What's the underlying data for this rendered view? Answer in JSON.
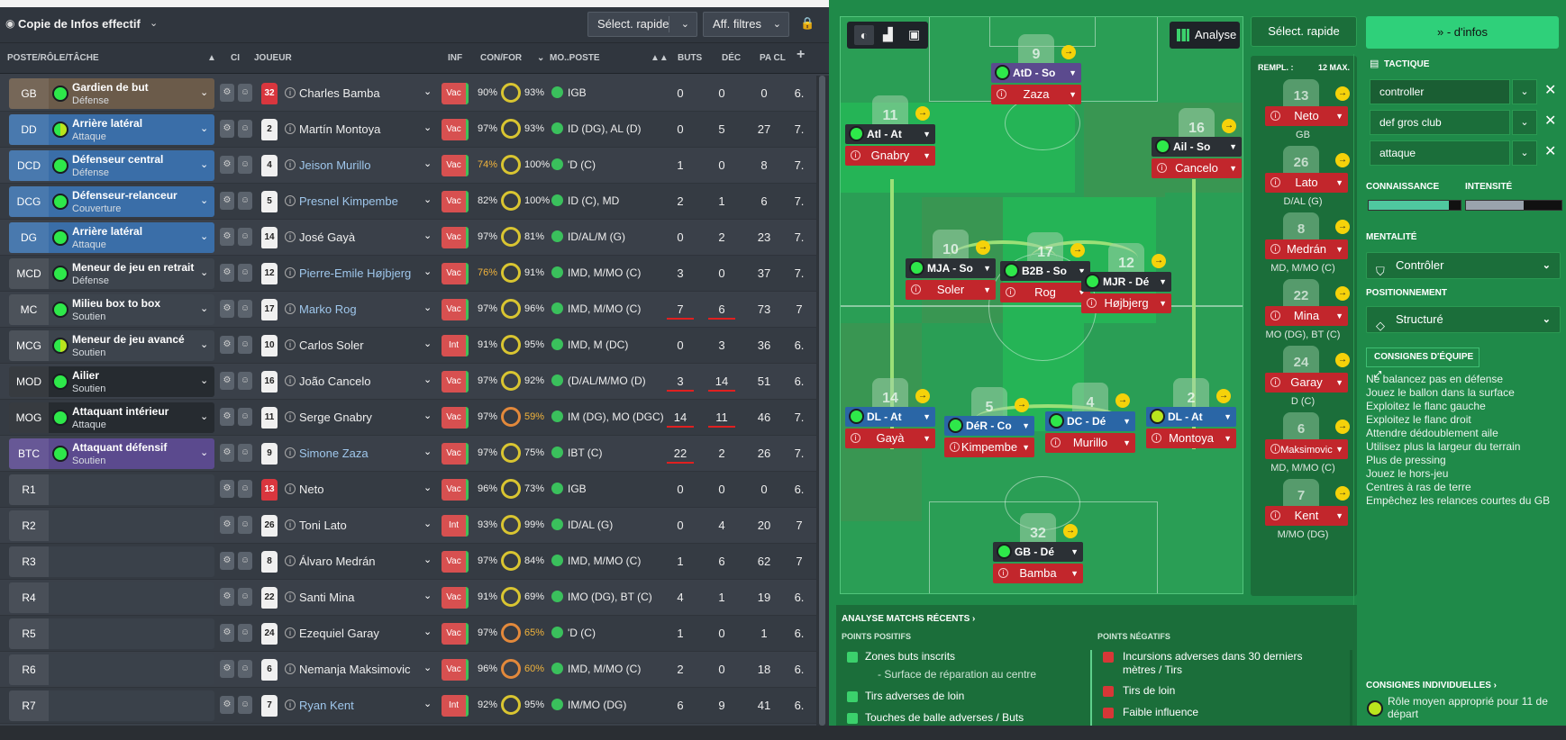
{
  "toolbar": {
    "title": "Copie de Infos effectif",
    "quick_select": "Sélect. rapide",
    "filters": "Aff. filtres"
  },
  "columns": {
    "role": "POSTE/RÔLE/TÂCHE",
    "ci": "CI",
    "player": "JOUEUR",
    "inf": "INF",
    "confor": "CON/FOR",
    "mopos": "MO..POSTE",
    "goals": "BUTS",
    "assists": "DÉC",
    "pacl": "PA CL",
    "plus": "+"
  },
  "rows": [
    {
      "pos": "GB",
      "role": "Gardien de but",
      "duty": "Défense",
      "num": "32",
      "name": "Charles Bamba",
      "inf": "Vac",
      "con": "90%",
      "for": "93%",
      "post": "IGB",
      "buts": "0",
      "dec": "0",
      "pa": "0",
      "x": "6."
    },
    {
      "pos": "DD",
      "role": "Arrière latéral",
      "duty": "Attaque",
      "num": "2",
      "name": "Martín Montoya",
      "inf": "Vac",
      "con": "97%",
      "for": "93%",
      "post": "ID (DG), AL (D)",
      "buts": "0",
      "dec": "5",
      "pa": "27",
      "x": "7."
    },
    {
      "pos": "DCD",
      "role": "Défenseur central",
      "duty": "Défense",
      "num": "4",
      "name": "Jeison Murillo",
      "inf": "Vac",
      "con": "74%",
      "for": "100%",
      "post": "'D (C)",
      "buts": "1",
      "dec": "0",
      "pa": "8",
      "x": "7."
    },
    {
      "pos": "DCG",
      "role": "Défenseur-relanceur",
      "duty": "Couverture",
      "num": "5",
      "name": "Presnel Kimpembe",
      "inf": "Vac",
      "con": "82%",
      "for": "100%",
      "post": "ID (C), MD",
      "buts": "2",
      "dec": "1",
      "pa": "6",
      "x": "7."
    },
    {
      "pos": "DG",
      "role": "Arrière latéral",
      "duty": "Attaque",
      "num": "14",
      "name": "José Gayà",
      "inf": "Vac",
      "con": "97%",
      "for": "81%",
      "post": "ID/AL/M (G)",
      "buts": "0",
      "dec": "2",
      "pa": "23",
      "x": "7."
    },
    {
      "pos": "MCD",
      "role": "Meneur de jeu en retrait",
      "duty": "Défense",
      "num": "12",
      "name": "Pierre-Emile Højbjerg",
      "inf": "Vac",
      "con": "76%",
      "for": "91%",
      "post": "IMD, M/MO (C)",
      "buts": "3",
      "dec": "0",
      "pa": "37",
      "x": "7."
    },
    {
      "pos": "MC",
      "role": "Milieu box to box",
      "duty": "Soutien",
      "num": "17",
      "name": "Marko Rog",
      "inf": "Vac",
      "con": "97%",
      "for": "96%",
      "post": "IMD, M/MO (C)",
      "buts": "7",
      "dec": "6",
      "pa": "73",
      "x": "7"
    },
    {
      "pos": "MCG",
      "role": "Meneur de jeu avancé",
      "duty": "Soutien",
      "num": "10",
      "name": "Carlos Soler",
      "inf": "Int",
      "con": "91%",
      "for": "95%",
      "post": "IMD, M (DC)",
      "buts": "0",
      "dec": "3",
      "pa": "36",
      "x": "6."
    },
    {
      "pos": "MOD",
      "role": "Ailier",
      "duty": "Soutien",
      "num": "16",
      "name": "João Cancelo",
      "inf": "Vac",
      "con": "97%",
      "for": "92%",
      "post": "(D/AL/M/MO (D)",
      "buts": "3",
      "dec": "14",
      "pa": "51",
      "x": "6."
    },
    {
      "pos": "MOG",
      "role": "Attaquant intérieur",
      "duty": "Attaque",
      "num": "11",
      "name": "Serge Gnabry",
      "inf": "Vac",
      "con": "97%",
      "for": "59%",
      "post": "IM (DG), MO (DGC)",
      "buts": "14",
      "dec": "11",
      "pa": "46",
      "x": "7."
    },
    {
      "pos": "BTC",
      "role": "Attaquant défensif",
      "duty": "Soutien",
      "num": "9",
      "name": "Simone Zaza",
      "inf": "Vac",
      "con": "97%",
      "for": "75%",
      "post": "IBT (C)",
      "buts": "22",
      "dec": "2",
      "pa": "26",
      "x": "7."
    },
    {
      "pos": "R1",
      "role": "",
      "duty": "",
      "num": "13",
      "name": "Neto",
      "inf": "Vac",
      "con": "96%",
      "for": "73%",
      "post": "IGB",
      "buts": "0",
      "dec": "0",
      "pa": "0",
      "x": "6."
    },
    {
      "pos": "R2",
      "role": "",
      "duty": "",
      "num": "26",
      "name": "Toni Lato",
      "inf": "Int",
      "con": "93%",
      "for": "99%",
      "post": "ID/AL (G)",
      "buts": "0",
      "dec": "4",
      "pa": "20",
      "x": "7"
    },
    {
      "pos": "R3",
      "role": "",
      "duty": "",
      "num": "8",
      "name": "Álvaro Medrán",
      "inf": "Vac",
      "con": "97%",
      "for": "84%",
      "post": "IMD, M/MO (C)",
      "buts": "1",
      "dec": "6",
      "pa": "62",
      "x": "7"
    },
    {
      "pos": "R4",
      "role": "",
      "duty": "",
      "num": "22",
      "name": "Santi Mina",
      "inf": "Vac",
      "con": "91%",
      "for": "69%",
      "post": "IMO (DG), BT (C)",
      "buts": "4",
      "dec": "1",
      "pa": "19",
      "x": "6."
    },
    {
      "pos": "R5",
      "role": "",
      "duty": "",
      "num": "24",
      "name": "Ezequiel Garay",
      "inf": "Vac",
      "con": "97%",
      "for": "65%",
      "post": "'D (C)",
      "buts": "1",
      "dec": "0",
      "pa": "1",
      "x": "6."
    },
    {
      "pos": "R6",
      "role": "",
      "duty": "",
      "num": "6",
      "name": "Nemanja Maksimovic",
      "inf": "Vac",
      "con": "96%",
      "for": "60%",
      "post": "IMD, M/MO (C)",
      "buts": "2",
      "dec": "0",
      "pa": "18",
      "x": "6."
    },
    {
      "pos": "R7",
      "role": "",
      "duty": "",
      "num": "7",
      "name": "Ryan Kent",
      "inf": "Int",
      "con": "92%",
      "for": "95%",
      "post": "IM/MO (DG)",
      "buts": "6",
      "dec": "9",
      "pa": "41",
      "x": "6."
    }
  ],
  "pitch": {
    "analyse_label": "Analyse",
    "players": [
      {
        "num": "9",
        "role": "AtD - So",
        "name": "Zaza"
      },
      {
        "num": "11",
        "role": "Atl - At",
        "name": "Gnabry"
      },
      {
        "num": "16",
        "role": "Ail - So",
        "name": "Cancelo"
      },
      {
        "num": "10",
        "role": "MJA - So",
        "name": "Soler"
      },
      {
        "num": "17",
        "role": "B2B - So",
        "name": "Rog"
      },
      {
        "num": "12",
        "role": "MJR - Dé",
        "name": "Højbjerg"
      },
      {
        "num": "14",
        "role": "DL - At",
        "name": "Gayà"
      },
      {
        "num": "5",
        "role": "DéR - Co",
        "name": "Kimpembe"
      },
      {
        "num": "4",
        "role": "DC - Dé",
        "name": "Murillo"
      },
      {
        "num": "2",
        "role": "DL - At",
        "name": "Montoya"
      },
      {
        "num": "32",
        "role": "GB - Dé",
        "name": "Bamba"
      }
    ]
  },
  "subs": {
    "quick_select": "Sélect. rapide",
    "header": "REMPL. :",
    "max": "12 MAX.",
    "list": [
      {
        "num": "13",
        "name": "Neto",
        "pos": "GB"
      },
      {
        "num": "26",
        "name": "Lato",
        "pos": "D/AL (G)"
      },
      {
        "num": "8",
        "name": "Medrán",
        "pos": "MD, M/MO (C)"
      },
      {
        "num": "22",
        "name": "Mina",
        "pos": "MO (DG), BT (C)"
      },
      {
        "num": "24",
        "name": "Garay",
        "pos": "D (C)"
      },
      {
        "num": "6",
        "name": "Maksimovic",
        "pos": "MD, M/MO (C)"
      },
      {
        "num": "7",
        "name": "Kent",
        "pos": "M/MO (DG)"
      }
    ]
  },
  "tactic": {
    "infos_button": "- d'infos",
    "title": "TACTIQUE",
    "fields": [
      "controller",
      "def gros club",
      "attaque"
    ],
    "knowledge": "CONNAISSANCE",
    "intensity": "INTENSITÉ",
    "knowledge_level": 0.87,
    "intensity_level": 0.6,
    "mentality_label": "MENTALITÉ",
    "mentality": "Contrôler",
    "positioning_label": "POSITIONNEMENT",
    "positioning": "Structuré",
    "team_instructions": "CONSIGNES D'ÉQUIPE",
    "instructions": [
      "Ne balancez pas en défense",
      "Jouez le ballon dans la surface",
      "Exploitez le flanc gauche",
      "Exploitez le flanc droit",
      "Attendre dédoublement aile",
      "Utilisez plus la largeur du terrain",
      "Plus de pressing",
      "Jouez le hors-jeu",
      "Centres à ras de terre",
      "Empêchez les relances courtes du GB"
    ],
    "individual": "CONSIGNES INDIVIDUELLES ›",
    "individual_text": "Rôle moyen approprié pour 11 de départ"
  },
  "analysis": {
    "title": "ANALYSE MATCHS RÉCENTS ›",
    "positives_label": "POINTS POSITIFS",
    "negatives_label": "POINTS NÉGATIFS",
    "positives": [
      "Zones buts inscrits",
      "- Surface de réparation au centre",
      "Tirs adverses de loin",
      "Touches de balle adverses / Buts"
    ],
    "negatives": [
      "Incursions adverses dans 30 derniers",
      "mètres / Tirs",
      "Tirs de loin",
      "Faible influence"
    ]
  },
  "colors": {
    "accent": "#2fd07a",
    "pitch": "#2da85a",
    "panel": "#1b6e3a",
    "name_box": "#c2262c",
    "fit": "#2ee84a"
  }
}
